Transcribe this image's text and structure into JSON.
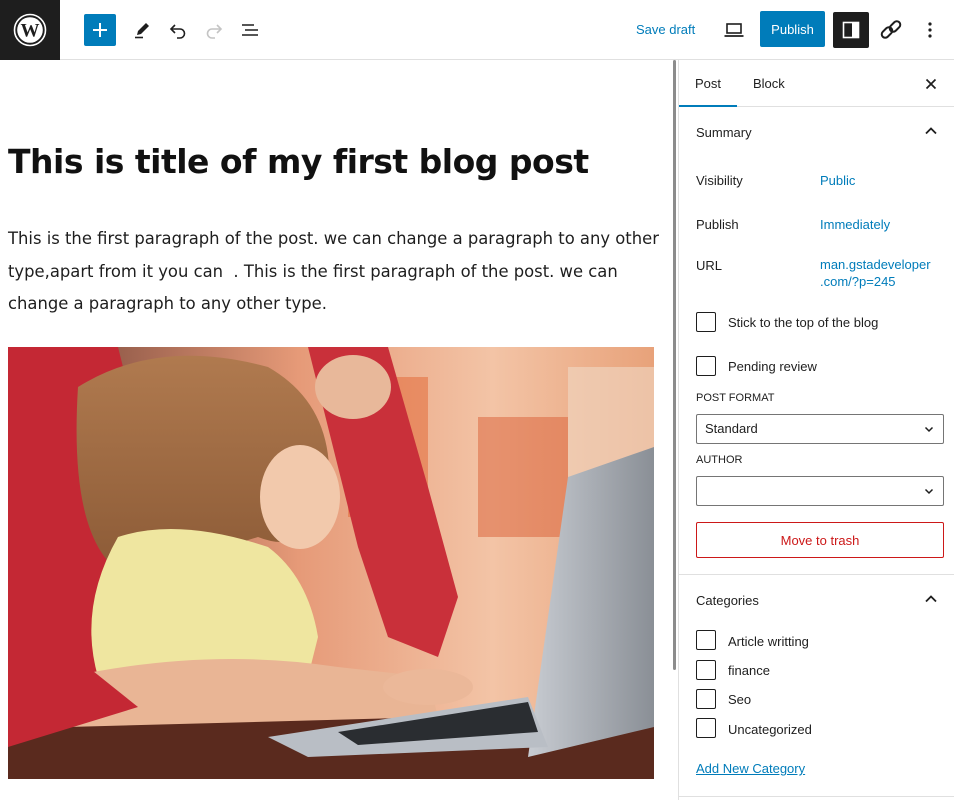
{
  "toolbar": {
    "save_draft_label": "Save draft",
    "publish_label": "Publish",
    "accent_color": "#007cba"
  },
  "post": {
    "title": "This is title of my first blog post",
    "paragraph": "This is the first paragraph of the post. we can change a paragraph to any other type,apart from it you can  . This is the first paragraph of the post. we can change a paragraph to any other type."
  },
  "sidebar": {
    "tabs": [
      {
        "label": "Post",
        "active": true
      },
      {
        "label": "Block",
        "active": false
      }
    ],
    "summary": {
      "title": "Summary",
      "visibility_label": "Visibility",
      "visibility_value": "Public",
      "publish_label": "Publish",
      "publish_value": "Immediately",
      "url_label": "URL",
      "url_value_line1": "man.gstadeveloper",
      "url_value_line2": ".com/?p=245",
      "stick_label": "Stick to the top of the blog",
      "pending_label": "Pending review",
      "post_format_label": "POST FORMAT",
      "post_format_value": "Standard",
      "author_label": "AUTHOR",
      "author_value": "",
      "trash_label": "Move to trash"
    },
    "categories": {
      "title": "Categories",
      "items": [
        "Article writting",
        "finance",
        "Seo",
        "Uncategorized"
      ],
      "add_new_label": "Add New Category"
    }
  },
  "icons": [
    "wordpress-icon",
    "plus-icon",
    "pencil-icon",
    "undo-icon",
    "redo-icon",
    "list-view-icon",
    "preview-icon",
    "sidebar-toggle-icon",
    "link-icon",
    "more-options-icon",
    "close-icon",
    "chevron-up-icon",
    "chevron-down-icon"
  ]
}
